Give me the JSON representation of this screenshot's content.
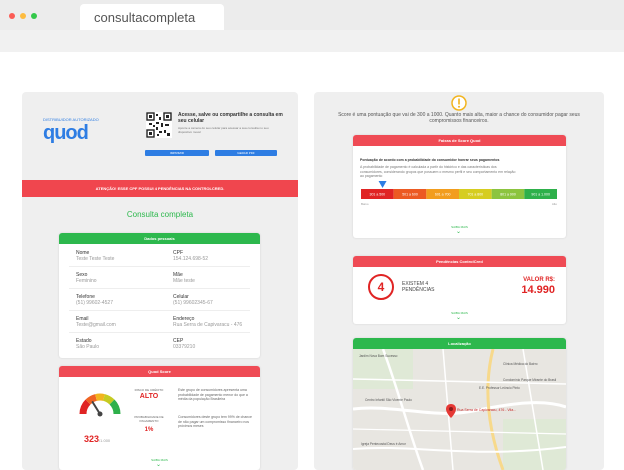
{
  "browser": {
    "tab_title": "consultacompleta",
    "colors": {
      "close": "#fb5c55",
      "minimize": "#fdbc40",
      "maximize": "#34c84a"
    }
  },
  "left": {
    "distributor_label": "DISTRIBUIDOR AUTORIZADO",
    "logo_text": "quod",
    "qr_title": "Acesse, salve ou compartilhe a consulta em seu celular",
    "qr_subtitle": "Aponte a camera do seu celular para acessar a sua consulta no seu dispositivo movel",
    "btn_print": "IMPRIMIR",
    "btn_pdf": "GERAR PDF",
    "alert": "ATENÇÃO! ESSE CPF POSSUI 4 PENDÊNCIAS NA CONTROLCRED.",
    "title": "Consulta completa",
    "personal": {
      "header": "Dados pessoais",
      "fields": [
        {
          "label": "Nome",
          "value": "Teste Teste Teste"
        },
        {
          "label": "CPF",
          "value": "154.124.698-52"
        },
        {
          "label": "Sexo",
          "value": "Feminino"
        },
        {
          "label": "Mãe",
          "value": "Mãe teste"
        },
        {
          "label": "Telefone",
          "value": "(51) 99602-4527"
        },
        {
          "label": "Celular",
          "value": "(51) 99602345-67"
        },
        {
          "label": "Email",
          "value": "Teste@gmail.com"
        },
        {
          "label": "Endereço",
          "value": "Rua Serra de Capivaracu - 476"
        },
        {
          "label": "Estado",
          "value": "São Paulo"
        },
        {
          "label": "CEP",
          "value": "03379210"
        }
      ]
    },
    "score": {
      "header": "Quod Score",
      "value": "323",
      "max": "/1.000",
      "score_fraction": 0.323,
      "risk_label": "RISCO DE CRÉDITO",
      "risk_value": "ALTO",
      "prob_label": "PROBABILIDADE DE PAGAMENTO",
      "prob_value": "1%",
      "desc1": "Este grupo de consumidores apresenta uma probabilidade de pagamento menor do que a média da população Brasileira",
      "desc2": "Consumidores deste grupo tem 99% de chance de não pagar um compromisso financeiro nos próximos meses",
      "more": "SAIBA MAIS"
    }
  },
  "right": {
    "intro": "Score é uma pontuação que vai de 300 a 1000. Quanto mais alta, maior a chance do consumidor pagar seus compromissos financeiros.",
    "faixas": {
      "header": "Faixas de Score Quod",
      "line1": "Pontuação de acordo com a probabilidade do consumidor honrar seus pagamentos",
      "line2": "A probabilidade de pagamento é calculada a partir do histórico e das características dos consumidores, considerando grupos que possuem o mesmo perfil e seu comportamento em relação ao pagamento",
      "bands": [
        "301 a 500",
        "501 a 600",
        "601 a 700",
        "701 a 800",
        "801 a 900",
        "901 a 1.000"
      ],
      "band_colors": [
        "#e02424",
        "#ec5a23",
        "#f29d1e",
        "#d6cd20",
        "#8cc43f",
        "#2eb04b"
      ],
      "min_label": "Baixo",
      "max_label": "Alto",
      "marker_fraction": 0.11,
      "more": "SAIBA MAIS"
    },
    "pendencias": {
      "header": "Pendências ControlCred",
      "count": "4",
      "label": "EXISTEM 4 PENDÊNCIAS",
      "valor_label": "VALOR R$:",
      "valor": "14.990",
      "more": "SAIBA MAIS"
    },
    "location": {
      "header": "Localização",
      "pin_label": "Rua Serra de Capivaracu, 476 - Vila...",
      "places": [
        "Jardim Nova Bom Sucesso",
        "Centro Infantil São Vicente Paulo",
        "Clinica Médica do Bairro",
        "Condomínio Parque Mirante do Brasil",
        "E.E. Professor Leôncio Pinto",
        "Igreja Pentecostal Deus é Amor"
      ]
    }
  }
}
